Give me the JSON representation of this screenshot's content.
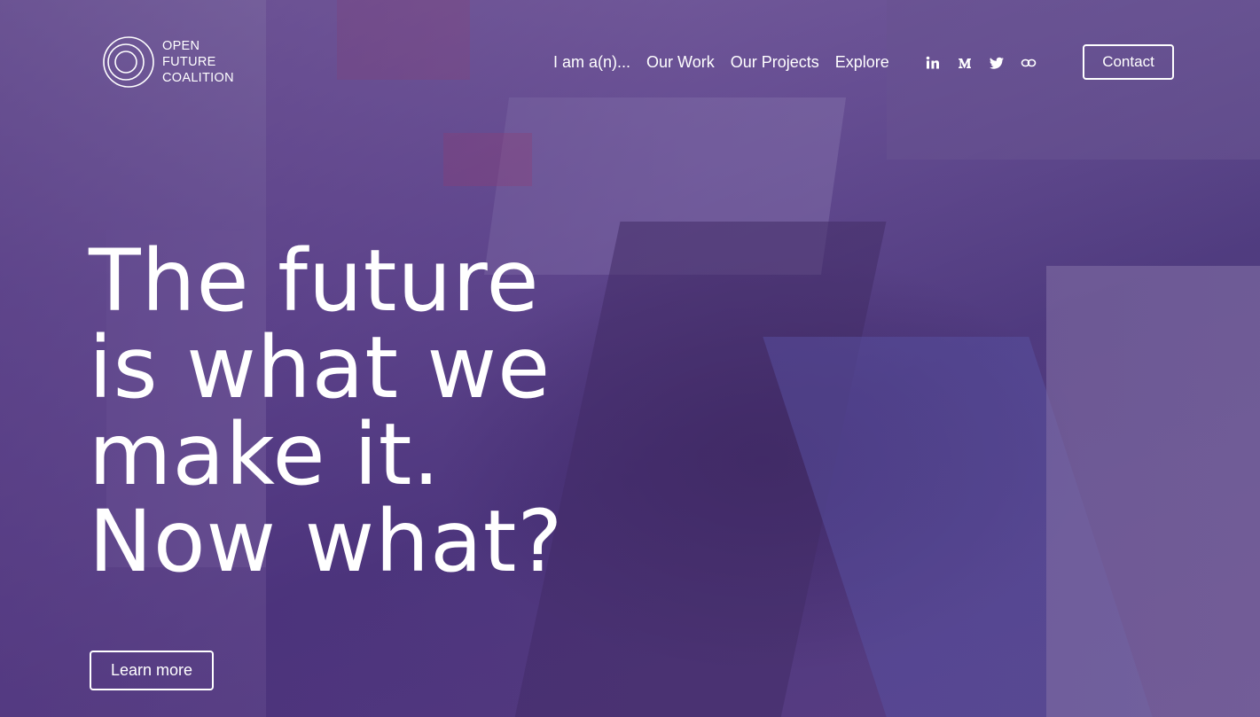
{
  "brand": {
    "logo_lines": [
      "OPEN",
      "FUTURE",
      "COALITION"
    ]
  },
  "nav": {
    "items": [
      {
        "label": "I am a(n)..."
      },
      {
        "label": "Our Work"
      },
      {
        "label": "Our Projects"
      },
      {
        "label": "Explore"
      }
    ]
  },
  "social": {
    "icons": [
      "linkedin-icon",
      "medium-icon",
      "twitter-icon",
      "link-icon"
    ]
  },
  "header": {
    "contact_label": "Contact"
  },
  "hero": {
    "headline_lines": [
      "The future",
      "is what we",
      "make it.",
      "Now what?"
    ],
    "cta_label": "Learn more"
  },
  "colors": {
    "text": "#ffffff",
    "overlay": "#5a3f86"
  }
}
